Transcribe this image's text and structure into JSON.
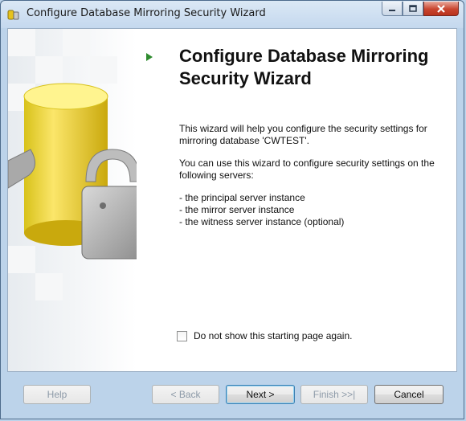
{
  "window": {
    "title": "Configure Database Mirroring Security Wizard",
    "icon": "wizard-app-icon",
    "caption_buttons": [
      "minimize-icon",
      "maximize-icon",
      "close-icon"
    ]
  },
  "content": {
    "heading": "Configure Database Mirroring Security Wizard",
    "intro": "This wizard will help you configure the security settings for mirroring database 'CWTEST'.",
    "usage": "You can use this wizard to configure security settings on the following servers:",
    "servers": [
      "- the principal server instance",
      "- the mirror server instance",
      "- the witness server instance (optional)"
    ],
    "checkbox": {
      "label": "Do not show this starting page again.",
      "checked": false
    }
  },
  "buttons": {
    "help": "Help",
    "back": "< Back",
    "next": "Next >",
    "finish": "Finish >>|",
    "cancel": "Cancel"
  },
  "colors": {
    "accent_arrow": "#2e8b2e",
    "chrome": "#bcd3ea",
    "close_button": "#c9452f"
  }
}
